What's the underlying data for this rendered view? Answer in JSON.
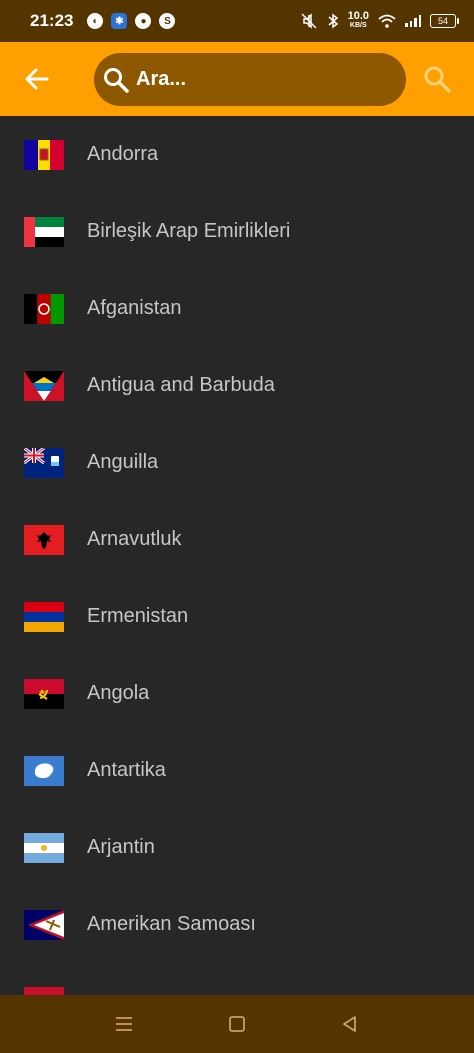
{
  "status_bar": {
    "time": "21:23",
    "net_speed_value": "10.0",
    "net_speed_unit": "KB/S",
    "battery": "54"
  },
  "app_bar": {
    "search_placeholder": "Ara..."
  },
  "countries": [
    {
      "name": "Andorra"
    },
    {
      "name": "Birleşik Arap Emirlikleri"
    },
    {
      "name": "Afganistan"
    },
    {
      "name": "Antigua and Barbuda"
    },
    {
      "name": "Anguilla"
    },
    {
      "name": "Arnavutluk"
    },
    {
      "name": "Ermenistan"
    },
    {
      "name": "Angola"
    },
    {
      "name": "Antartika"
    },
    {
      "name": "Arjantin"
    },
    {
      "name": "Amerikan Samoası"
    },
    {
      "name": ""
    }
  ],
  "colors": {
    "app_bar": "#ffa000",
    "search_box": "#8e5800",
    "status_bar": "#543500",
    "background": "#272727",
    "text": "#c6c6c6"
  }
}
